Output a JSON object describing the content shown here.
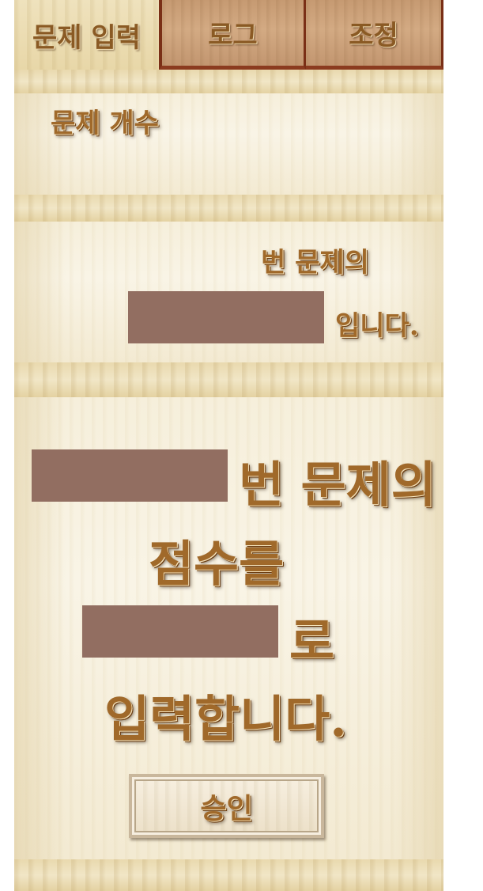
{
  "tabs": {
    "problem_input": "문제 입력",
    "log": "로그",
    "adjust": "조정"
  },
  "problem_count": {
    "label": "문제 개수"
  },
  "answer_section": {
    "number_suffix": "번 문제의",
    "answer_suffix": "입니다."
  },
  "score_section": {
    "number_suffix": "번 문제의",
    "score_label": "점수를",
    "value_suffix": "로",
    "action_text": "입력합니다."
  },
  "approve_button": {
    "label": "승인"
  },
  "colors": {
    "field_fill": "#926e61",
    "text_gold": "#a0692a",
    "tab_border": "#8b3b1f"
  }
}
